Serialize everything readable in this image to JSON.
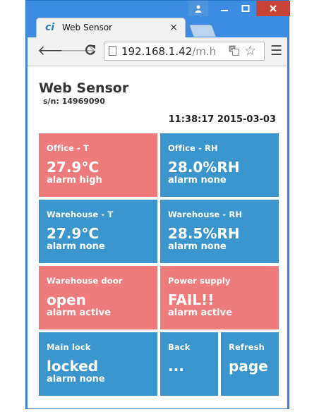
{
  "tab": {
    "favicon": "ci",
    "title": "Web Sensor",
    "close": "×"
  },
  "address": {
    "host": "192.168.1.42",
    "path": "/m.h"
  },
  "page": {
    "title": "Web Sensor",
    "serial": "s/n: 14969090",
    "datetime": "11:38:17 2015-03-03"
  },
  "tiles": [
    {
      "label": "Office - T",
      "value": "27.9°C",
      "status": "alarm high",
      "color": "#ef7c7c"
    },
    {
      "label": "Office - RH",
      "value": "28.0%RH",
      "status": "alarm none",
      "color": "#3a96cc"
    },
    {
      "label": "Warehouse - T",
      "value": "27.9°C",
      "status": "alarm none",
      "color": "#3a96cc"
    },
    {
      "label": "Warehouse - RH",
      "value": "28.5%RH",
      "status": "alarm none",
      "color": "#3a96cc"
    },
    {
      "label": "Warehouse door",
      "value": "open",
      "status": "alarm active",
      "color": "#ef7c7c"
    },
    {
      "label": "Power supply",
      "value": "FAIL!!",
      "status": "alarm active",
      "color": "#ef7c7c"
    },
    {
      "label": "Main lock",
      "value": "locked",
      "status": "alarm none",
      "color": "#3a96cc"
    },
    {
      "label": "Back",
      "value": "...",
      "status": "",
      "color": "#3a96cc"
    },
    {
      "label": "Refresh",
      "value": "page",
      "status": "",
      "color": "#3a96cc"
    }
  ],
  "icons": {
    "window": [
      "user-icon",
      "minimize-icon",
      "maximize-icon",
      "close-icon"
    ],
    "toolbar": [
      "back-arrow-icon",
      "forward-arrow-icon",
      "reload-icon",
      "page-icon",
      "translate-icon",
      "bookmark-star-icon",
      "menu-icon"
    ]
  }
}
